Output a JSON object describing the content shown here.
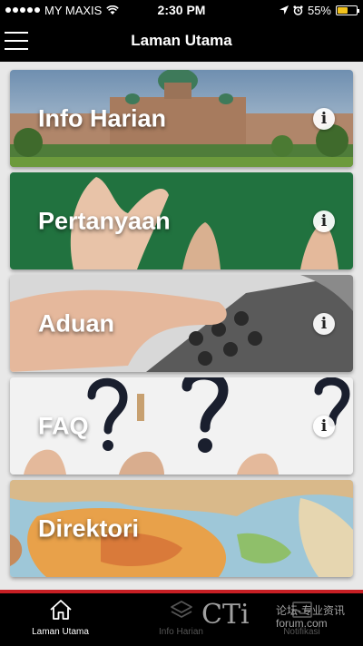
{
  "status_bar": {
    "carrier": "MY MAXIS",
    "time": "2:30 PM",
    "battery": "55%",
    "battery_level": 0.55
  },
  "header": {
    "title": "Laman Utama",
    "menu_icon": "hamburger-menu-icon"
  },
  "cards": [
    {
      "label": "Info Harian",
      "icon": "info-icon"
    },
    {
      "label": "Pertanyaan",
      "icon": "info-icon"
    },
    {
      "label": "Aduan",
      "icon": "info-icon"
    },
    {
      "label": "FAQ",
      "icon": "info-icon"
    },
    {
      "label": "Direktori",
      "icon": "info-icon"
    }
  ],
  "tabs": [
    {
      "label": "Laman Utama",
      "icon": "home-icon",
      "active": true
    },
    {
      "label": "Info Harian",
      "icon": "layers-icon",
      "active": false
    },
    {
      "label": "Notifikasi",
      "icon": "inbox-icon",
      "active": false
    }
  ],
  "watermark": {
    "brand": "CTi",
    "tagline": "论坛-专业资讯",
    "url": "forum.com"
  },
  "colors": {
    "accent_red": "#c71f24",
    "battery_yellow": "#f2c21b"
  }
}
